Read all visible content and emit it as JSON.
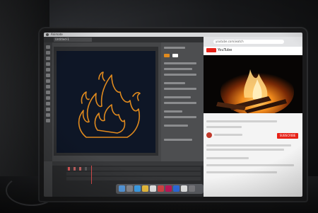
{
  "scene": {
    "description_free": true
  },
  "menubar": {
    "app_name": "Animate",
    "clock": ""
  },
  "app": {
    "document_tab": "Untitled-1",
    "stroke_color": "#e08a1e"
  },
  "browser": {
    "url": "youtube.com/watch",
    "site_name": "YouTube",
    "video_title": "",
    "channel_name": "",
    "views": "",
    "subscribe_label": "SUBSCRIBE"
  }
}
